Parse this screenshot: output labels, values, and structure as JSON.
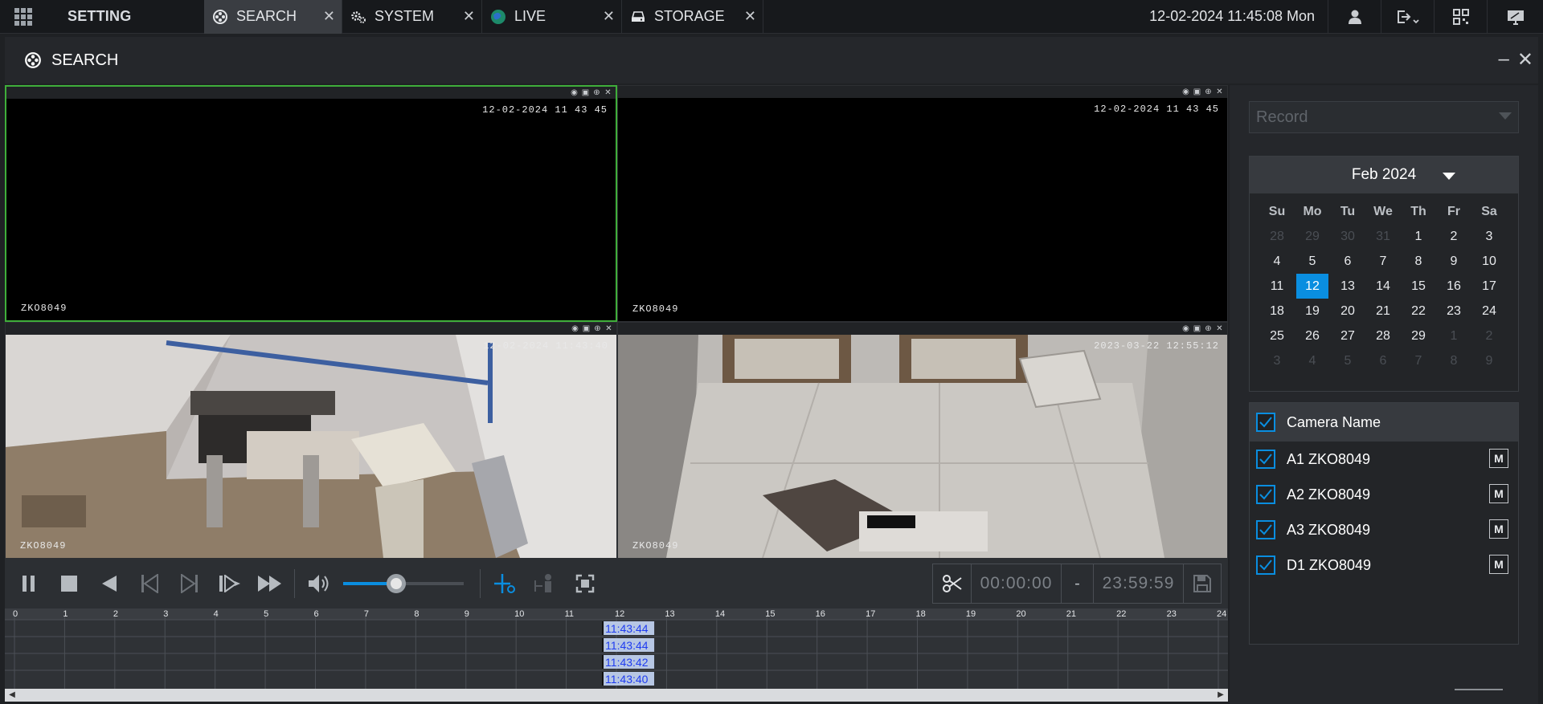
{
  "topbar": {
    "menu_icon": "grid-menu-icon",
    "setting_label": "SETTING",
    "tabs": [
      {
        "label": "SEARCH",
        "icon": "search-film-icon",
        "active": true
      },
      {
        "label": "SYSTEM",
        "icon": "gears-icon",
        "active": false
      },
      {
        "label": "LIVE",
        "icon": "globe-icon",
        "active": false
      },
      {
        "label": "STORAGE",
        "icon": "hdd-icon",
        "active": false
      }
    ],
    "close_glyph": "✕",
    "datetime": "12-02-2024 11:45:08 Mon",
    "right_icons": [
      "user-icon",
      "logout-icon",
      "qr-code-icon",
      "monitor-icon"
    ]
  },
  "subbar": {
    "title": "SEARCH",
    "minimize": "–",
    "close": "✕"
  },
  "video": {
    "cells": [
      {
        "timestamp": "12-02-2024 11 43 45",
        "camera": "ZKO8049",
        "selected": true,
        "scene": "black"
      },
      {
        "timestamp": "12-02-2024 11 43 45",
        "camera": "ZKO8049",
        "selected": false,
        "scene": "black"
      },
      {
        "timestamp": "12-02-2024 11:43:40",
        "camera": "ZKO8049",
        "selected": false,
        "scene": "room"
      },
      {
        "timestamp": "2023-03-22 12:55:12",
        "camera": "ZKO8049",
        "selected": false,
        "scene": "doorway"
      }
    ]
  },
  "controls": {
    "volume_level": 0.44,
    "clip_start": "00:00:00",
    "clip_dash": "-",
    "clip_end": "23:59:59"
  },
  "timeline": {
    "hours": [
      "0",
      "1",
      "2",
      "3",
      "4",
      "5",
      "6",
      "7",
      "8",
      "9",
      "10",
      "11",
      "12",
      "13",
      "14",
      "15",
      "16",
      "17",
      "18",
      "19",
      "20",
      "21",
      "22",
      "23",
      "24"
    ],
    "marker_times": [
      "11:43:44",
      "11:43:44",
      "11:43:42",
      "11:43:40"
    ]
  },
  "side": {
    "record_type": "Record",
    "calendar": {
      "month_label": "Feb 2024",
      "weekdays": [
        "Su",
        "Mo",
        "Tu",
        "We",
        "Th",
        "Fr",
        "Sa"
      ],
      "days": [
        {
          "d": "28",
          "o": true
        },
        {
          "d": "29",
          "o": true
        },
        {
          "d": "30",
          "o": true
        },
        {
          "d": "31",
          "o": true
        },
        {
          "d": "1"
        },
        {
          "d": "2"
        },
        {
          "d": "3"
        },
        {
          "d": "4"
        },
        {
          "d": "5"
        },
        {
          "d": "6"
        },
        {
          "d": "7"
        },
        {
          "d": "8"
        },
        {
          "d": "9"
        },
        {
          "d": "10"
        },
        {
          "d": "11"
        },
        {
          "d": "12",
          "t": true
        },
        {
          "d": "13"
        },
        {
          "d": "14"
        },
        {
          "d": "15"
        },
        {
          "d": "16"
        },
        {
          "d": "17"
        },
        {
          "d": "18"
        },
        {
          "d": "19"
        },
        {
          "d": "20"
        },
        {
          "d": "21"
        },
        {
          "d": "22"
        },
        {
          "d": "23"
        },
        {
          "d": "24"
        },
        {
          "d": "25"
        },
        {
          "d": "26"
        },
        {
          "d": "27"
        },
        {
          "d": "28"
        },
        {
          "d": "29"
        },
        {
          "d": "1",
          "o": true
        },
        {
          "d": "2",
          "o": true
        },
        {
          "d": "3",
          "o": true
        },
        {
          "d": "4",
          "o": true
        },
        {
          "d": "5",
          "o": true
        },
        {
          "d": "6",
          "o": true
        },
        {
          "d": "7",
          "o": true
        },
        {
          "d": "8",
          "o": true
        },
        {
          "d": "9",
          "o": true
        }
      ]
    },
    "camera_header": "Camera Name",
    "cameras": [
      {
        "name": "A1 ZKO8049",
        "mode": "M"
      },
      {
        "name": "A2 ZKO8049",
        "mode": "M"
      },
      {
        "name": "A3 ZKO8049",
        "mode": "M"
      },
      {
        "name": "D1 ZKO8049",
        "mode": "M"
      }
    ]
  },
  "colors": {
    "accent": "#0a8ee0",
    "selected_border": "#3fae3a",
    "marker_text": "#1f3cf0"
  }
}
